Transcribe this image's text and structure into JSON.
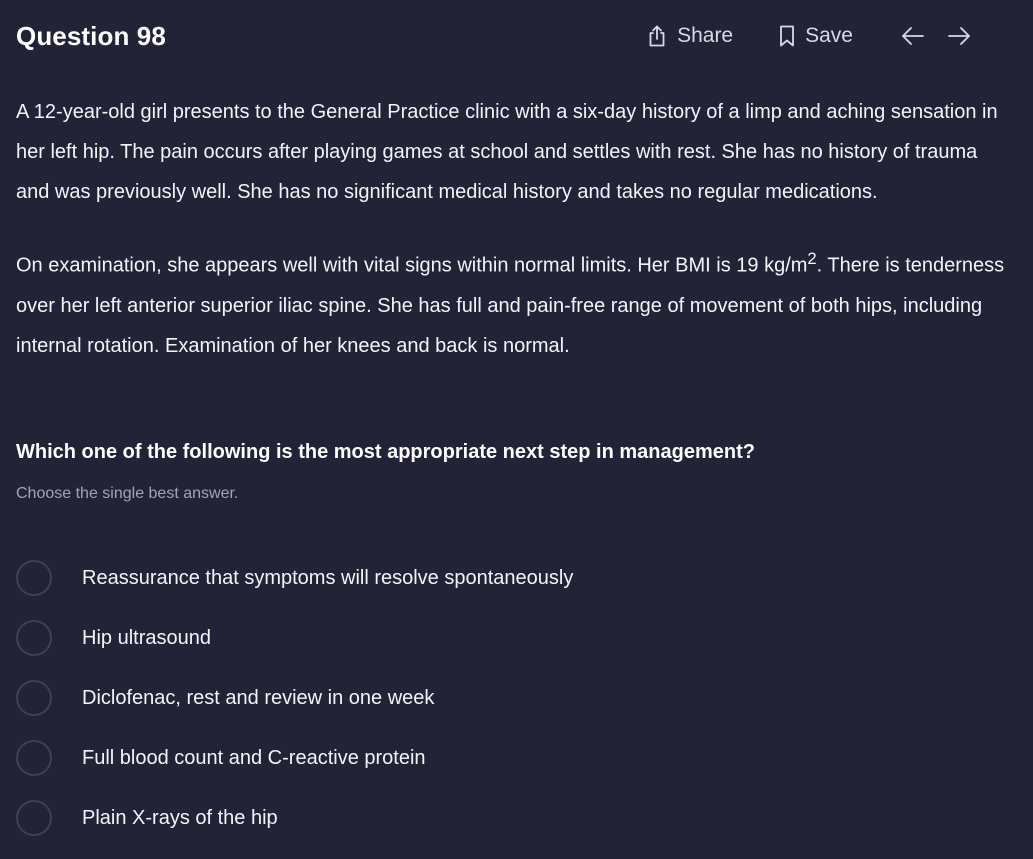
{
  "header": {
    "title": "Question 98",
    "share_label": "Share",
    "save_label": "Save",
    "share_icon": "share-icon",
    "save_icon": "bookmark-icon",
    "prev_icon": "arrow-left-icon",
    "next_icon": "arrow-right-icon"
  },
  "stem": {
    "paragraph1": "A 12-year-old girl presents to the General Practice clinic with a six-day history of a limp and aching sensation in her left hip. The pain occurs after playing games at school and settles with rest. She has no history of trauma and was previously well. She has no significant medical history and takes no regular medications.",
    "paragraph2_before": "On examination, she appears well with vital signs within normal limits. Her BMI is 19 kg/m",
    "paragraph2_superscript": "2",
    "paragraph2_after": ". There is tenderness over her left anterior superior iliac spine. She has full and pain-free range of movement of both hips, including internal rotation. Examination of her knees and back is normal."
  },
  "question": "Which one of the following is the most appropriate next step in management?",
  "instruction": "Choose the single best answer.",
  "options": [
    {
      "label": "Reassurance that symptoms will resolve spontaneously"
    },
    {
      "label": "Hip ultrasound"
    },
    {
      "label": "Diclofenac, rest and review in one week"
    },
    {
      "label": "Full blood count and C-reactive protein"
    },
    {
      "label": "Plain X-rays of the hip"
    }
  ],
  "colors": {
    "background": "#232338",
    "text": "#ffffff",
    "muted_text": "#a3a3b8",
    "radio_border": "#3f3f55"
  }
}
